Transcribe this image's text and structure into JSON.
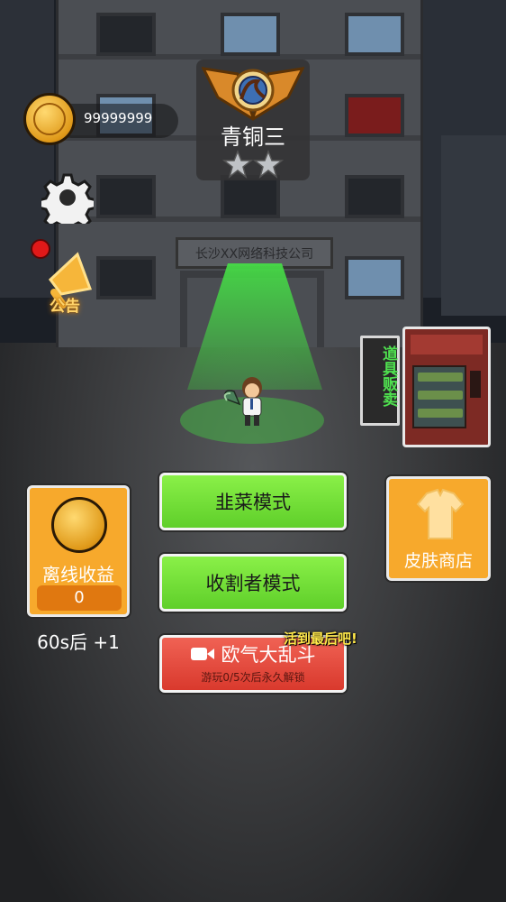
{
  "hud": {
    "coin_balance": "99999999",
    "notice_label": "公告"
  },
  "rank": {
    "name": "青铜三",
    "stars_filled": 0,
    "stars_total": 2
  },
  "building": {
    "sign_text": "长沙XX网络科技公司"
  },
  "vending": {
    "sign_label": "道具贩卖"
  },
  "offline_income": {
    "label": "离线收益",
    "value": "0",
    "timer": "60s后 +1"
  },
  "skin_shop": {
    "label": "皮肤商店"
  },
  "modes": {
    "jiucai_label": "韭菜模式",
    "reaper_label": "收割者模式",
    "brawl_label": "欧气大乱斗",
    "brawl_sub": "游玩0/5次后永久解锁",
    "brawl_tag": "活到最后吧!"
  },
  "colors": {
    "green_button": "#6bd634",
    "red_button": "#e04a3e",
    "orange_card": "#f7a92c",
    "beam_green": "#46dc46"
  }
}
